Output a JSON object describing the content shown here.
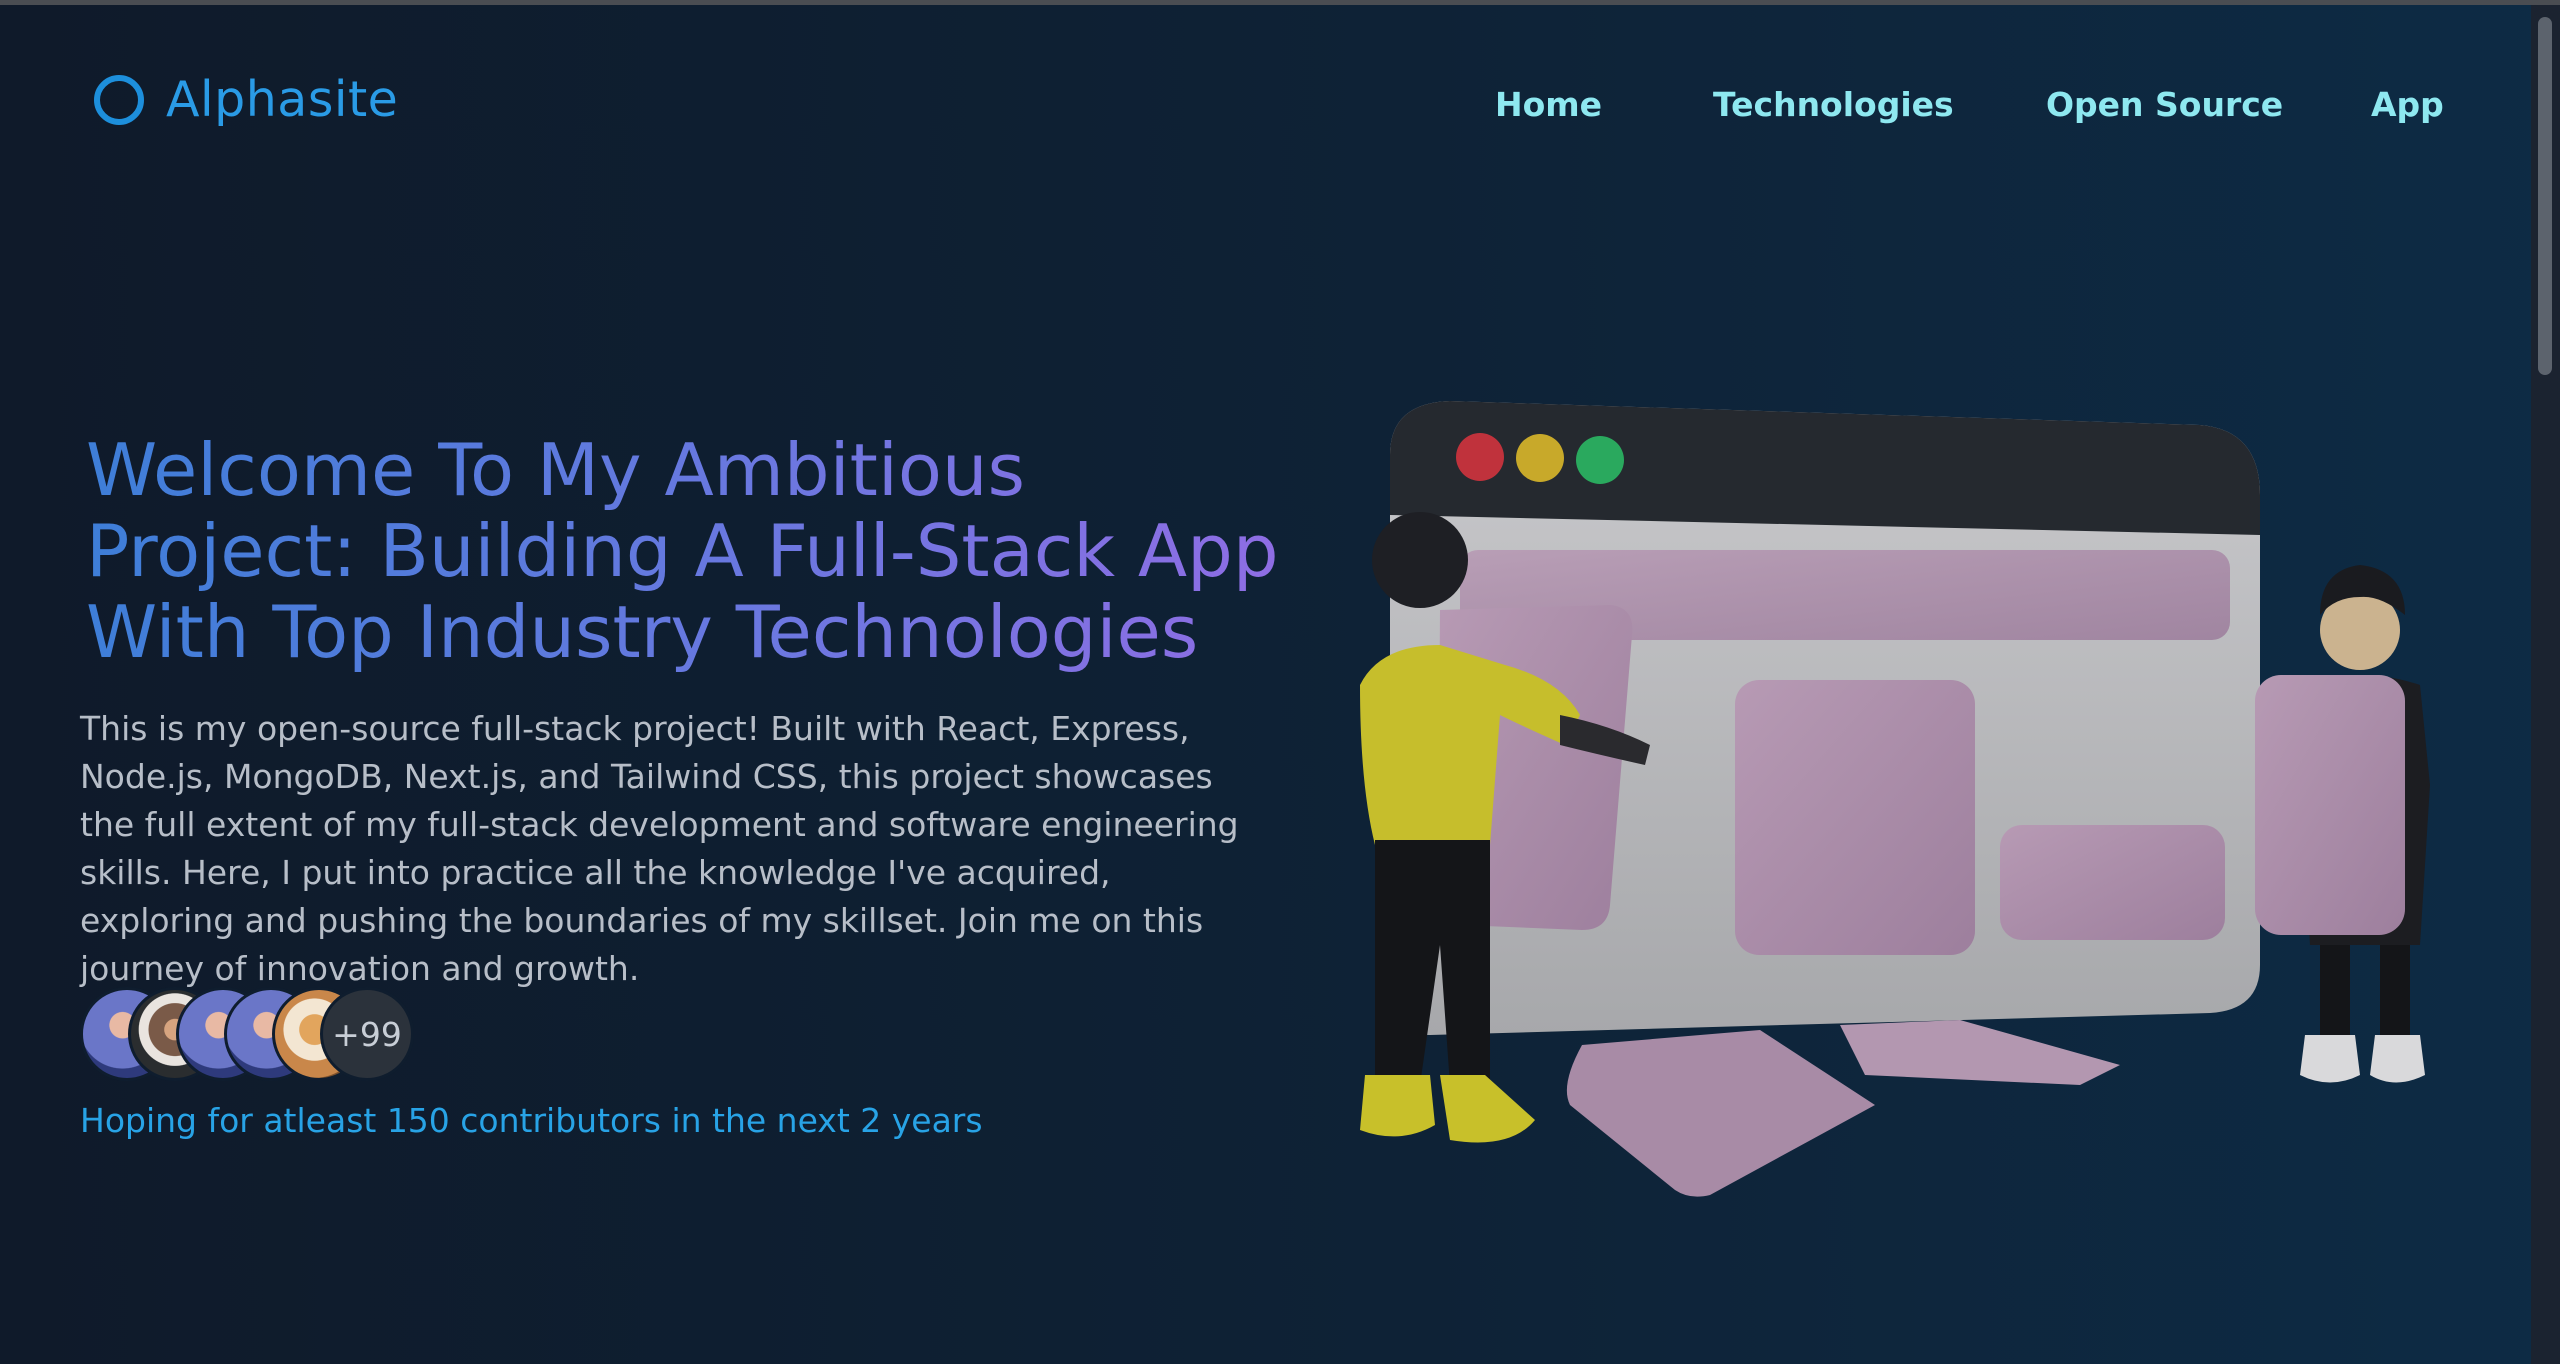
{
  "brand": {
    "name": "Alphasite",
    "logo_icon": "circle-ring-icon",
    "logo_color": "#1d8fdc"
  },
  "nav": {
    "items": [
      {
        "label": "Home"
      },
      {
        "label": "Technologies"
      },
      {
        "label": "Open Source"
      },
      {
        "label": "App"
      }
    ],
    "color": "#8ee8f0"
  },
  "hero": {
    "title_lines": [
      "Welcome To My Ambitious",
      "Project: Building A Full-Stack App",
      "With Top Industry Technologies"
    ],
    "description": "This is my open-source full-stack project! Built with React, Express, Node.js, MongoDB, Next.js, and Tailwind CSS, this project showcases the full extent of my full-stack development and software engineering skills. Here, I put into practice all the knowledge I've acquired, exploring and pushing the boundaries of my skillset. Join me on this journey of innovation and growth.",
    "contributors": {
      "avatars": [
        "avatar-blue-portrait",
        "avatar-bearded-man",
        "avatar-blue-portrait",
        "avatar-blue-portrait",
        "avatar-cat"
      ],
      "more_count": "+99"
    },
    "tagline": "Hoping for atleast 150 contributors in the next 2 years"
  },
  "colors": {
    "background_start": "#0f1a2a",
    "background_end": "#0d2b45",
    "title_gradient_start": "#3e7ed8",
    "title_gradient_end": "#8f6de4",
    "tagline": "#28a3e6"
  }
}
